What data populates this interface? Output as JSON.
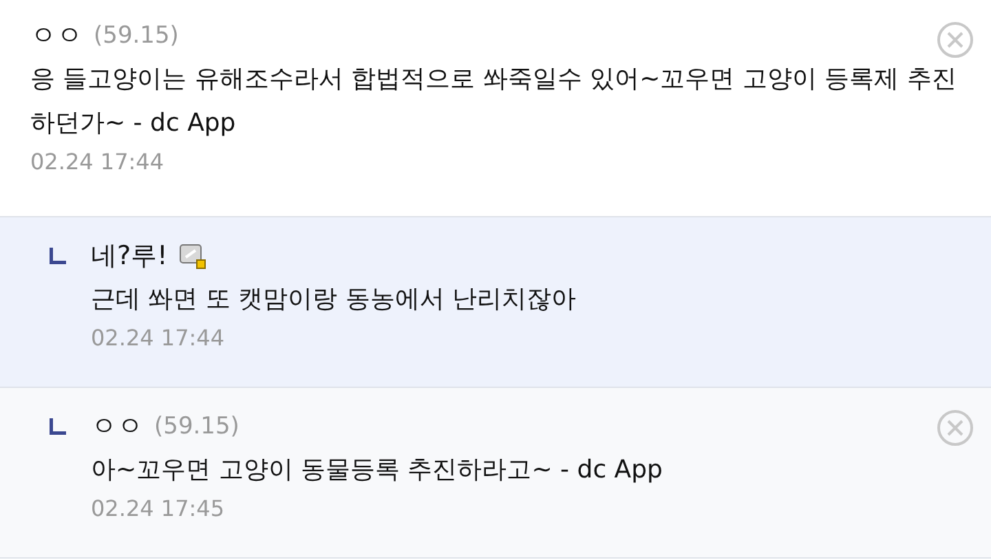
{
  "comments": [
    {
      "kind": "comment",
      "nick": "ㅇㅇ",
      "ip": "(59.15)",
      "fixed_nick": false,
      "deletable": true,
      "highlighted": false,
      "text": "응 들고양이는 유해조수라서 합법적으로 쏴죽일수 있어~꼬우면 고양이 등록제 추진하던가~ - dc App",
      "time": "02.24 17:44"
    },
    {
      "kind": "reply",
      "nick": "네?루!",
      "fixed_nick": true,
      "deletable": false,
      "highlighted": true,
      "text": "근데 쏴면 또 캣맘이랑 동농에서 난리치잖아",
      "time": "02.24 17:44"
    },
    {
      "kind": "reply",
      "nick": "ㅇㅇ",
      "ip": "(59.15)",
      "fixed_nick": false,
      "deletable": true,
      "highlighted": false,
      "text": "아~꼬우면 고양이 동물등록 추진하라고~ - dc App",
      "time": "02.24 17:45"
    }
  ]
}
